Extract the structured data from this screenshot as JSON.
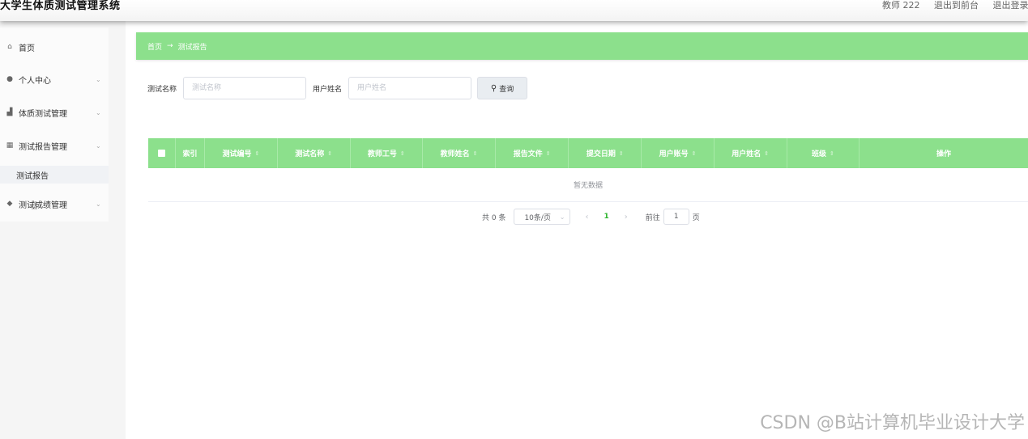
{
  "header": {
    "title": "大学生体质测试管理系统",
    "user": "教师 222",
    "exit_front": "退出到前台",
    "logout": "退出登录"
  },
  "sidebar": {
    "items": [
      {
        "label": "首页",
        "icon": "home-icon"
      },
      {
        "label": "个人中心",
        "icon": "user-icon"
      },
      {
        "label": "体质测试管理",
        "icon": "chart-icon"
      },
      {
        "label": "测试报告管理",
        "icon": "grid-icon"
      },
      {
        "label": "测试成绩管理",
        "icon": "pin-icon"
      }
    ],
    "submenu": {
      "label": "测试报告"
    }
  },
  "breadcrumb": {
    "home": "首页",
    "arrow": "→",
    "current": "测试报告"
  },
  "search": {
    "test_name_label": "测试名称",
    "test_name_placeholder": "测试名称",
    "user_name_label": "用户姓名",
    "user_name_placeholder": "用户姓名",
    "query_label": "查询"
  },
  "table": {
    "columns": [
      "索引",
      "测试编号",
      "测试名称",
      "教师工号",
      "教师姓名",
      "报告文件",
      "提交日期",
      "用户账号",
      "用户姓名",
      "班级",
      "操作"
    ],
    "empty_text": "暂无数据"
  },
  "pagination": {
    "total": "共 0 条",
    "page_size": "10条/页",
    "current_page": "1",
    "goto_label": "前往",
    "goto_value": "1",
    "goto_suffix": "页"
  },
  "watermark": "CSDN @B站计算机毕业设计大学"
}
